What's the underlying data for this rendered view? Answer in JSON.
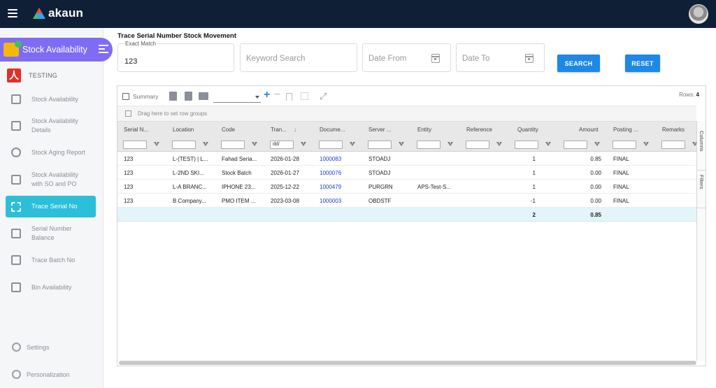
{
  "app": {
    "brand": "akaun"
  },
  "sidebar": {
    "module_title": "Stock Availability",
    "org_name": "TESTING",
    "org_logo_letter": "人",
    "items": [
      {
        "label": "Stock Availability",
        "icon": "box-icon",
        "active": false
      },
      {
        "label": "Stock Availability Details",
        "icon": "list-details-icon",
        "active": false
      },
      {
        "label": "Stock Aging Report",
        "icon": "clock-icon",
        "active": false
      },
      {
        "label": "Stock Availability with SO and PO",
        "icon": "box-icon",
        "active": false
      },
      {
        "label": "Trace Serial No",
        "icon": "barcode-scan-icon",
        "active": true
      },
      {
        "label": "Serial Number Balance",
        "icon": "scale-icon",
        "active": false
      },
      {
        "label": "Trace Batch No",
        "icon": "box-icon",
        "active": false
      },
      {
        "label": "Bin Availability",
        "icon": "list-icon",
        "active": false
      }
    ],
    "footer": [
      {
        "label": "Settings",
        "icon": "gear-icon"
      },
      {
        "label": "Personalization",
        "icon": "person-icon"
      }
    ],
    "colors": {
      "module_bg": "#7f6cf4",
      "active_bg": "#2bbfd9"
    }
  },
  "page": {
    "title": "Trace Serial Number Stock Movement"
  },
  "filters": {
    "exact_match_label": "Exact Match",
    "exact_match_value": "123",
    "keyword_placeholder": "Keyword Search",
    "date_from_placeholder": "Date From",
    "date_to_placeholder": "Date To",
    "search_label": "SEARCH",
    "reset_label": "RESET"
  },
  "grid": {
    "toolbar": {
      "summary_label": "Summary",
      "rows_label": "Rows:",
      "rows_count": "4"
    },
    "group_panel_text": "Drag here to set row groups",
    "date_filter_placeholder": "dd/",
    "columns": [
      "Serial N...",
      "Location",
      "Code",
      "Tran...",
      "Docume...",
      "Server ...",
      "Entity",
      "Reference",
      "Quantity",
      "Amount",
      "Posting ...",
      "Remarks"
    ],
    "sort_indicator": "↓",
    "rows": [
      [
        "123",
        "L-(TEST) | L...",
        "Fahad Seria...",
        "2026-01-28",
        "1000083",
        "STOADJ",
        "",
        "",
        "1",
        "0.85",
        "FINAL",
        ""
      ],
      [
        "123",
        "L-2ND SKI...",
        "Stock Batch",
        "2026-01-27",
        "1000076",
        "STOADJ",
        "",
        "",
        "1",
        "0.00",
        "FINAL",
        ""
      ],
      [
        "123",
        "L-A BRANC...",
        "IPHONE 23...",
        "2025-12-22",
        "1000479",
        "PURGRN",
        "APS-Test-S...",
        "",
        "1",
        "0.00",
        "FINAL",
        ""
      ],
      [
        "123",
        "B Company...",
        "PMO ITEM ...",
        "2023-03-08",
        "1000003",
        "OBDSTF",
        "",
        "",
        "-1",
        "0.00",
        "FINAL",
        ""
      ]
    ],
    "totals": {
      "quantity": "2",
      "amount": "0.85"
    },
    "side_tabs": [
      "Columns",
      "Filters"
    ]
  }
}
